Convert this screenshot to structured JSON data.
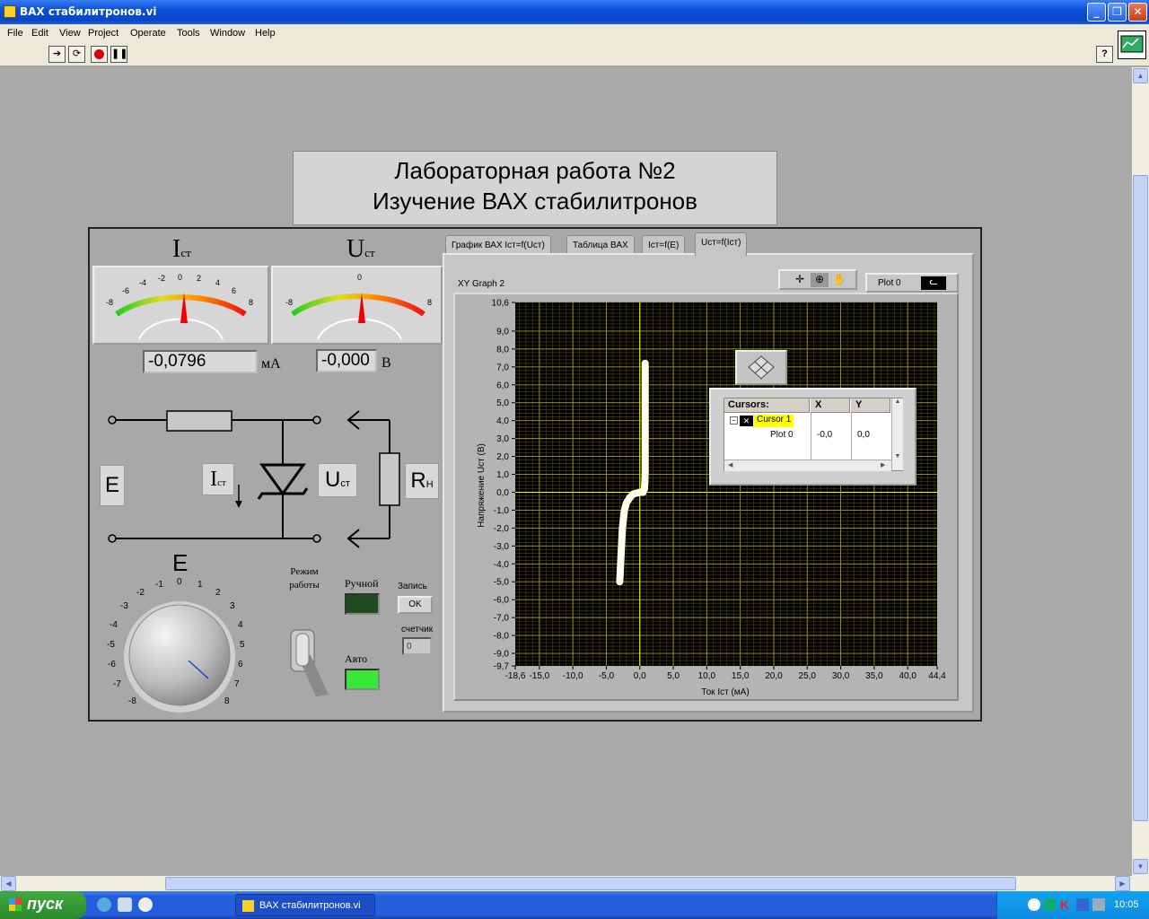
{
  "window": {
    "title": "ВАХ стабилитронов.vi"
  },
  "menu": [
    "File",
    "Edit",
    "View",
    "Project",
    "Operate",
    "Tools",
    "Window",
    "Help"
  ],
  "panel": {
    "title_line1": "Лабораторная работа №2",
    "title_line2": "Изучение ВАХ стабилитронов",
    "meter_i": {
      "label": "I",
      "sub": "ст",
      "ticks": [
        "-8",
        "-6",
        "-4",
        "-2",
        "0",
        "2",
        "4",
        "6",
        "8"
      ],
      "value": "-0,0796",
      "unit": "мА"
    },
    "meter_u": {
      "label": "U",
      "sub": "ст",
      "ticks": [
        "-8",
        "0",
        "8"
      ],
      "value": "-0,000",
      "unit": "В"
    },
    "circuit": {
      "e_label": "E",
      "i_label": "I",
      "i_sub": "ст",
      "u_label": "U",
      "u_sub": "ст",
      "r_label": "R",
      "r_sub": "Н"
    },
    "knob": {
      "label": "E",
      "ticks": [
        "-8",
        "-7",
        "-6",
        "-5",
        "-4",
        "-3",
        "-2",
        "-1",
        "0",
        "1",
        "2",
        "3",
        "4",
        "5",
        "6",
        "7",
        "8"
      ]
    },
    "mode": {
      "label": "Режим работы",
      "manual": "Ручной",
      "auto": "Авто",
      "record": "Запись",
      "ok": "OK",
      "counter_label": "счетчик",
      "counter_value": "0"
    },
    "tabs": [
      "График ВАХ Iст=f(Uст)",
      "Таблица ВАХ",
      "Iст=f(E)",
      "Uст=f(Iст)"
    ],
    "active_tab": 3,
    "graph": {
      "title": "XY Graph 2",
      "plot_legend": "Plot 0",
      "cursors": {
        "header": "Cursors:",
        "col_x": "X",
        "col_y": "Y",
        "cursor_name": "Cursor 1",
        "plot": "Plot 0",
        "x": "-0,0",
        "y": "0,0"
      }
    }
  },
  "chart_data": {
    "type": "line",
    "xlabel": "Ток Iст (мА)",
    "ylabel": "Напряжение Uст (В)",
    "xlim": [
      -18.6,
      44.4
    ],
    "ylim": [
      -9.7,
      10.6
    ],
    "x_ticks": [
      "-18,6",
      "-15,0",
      "-10,0",
      "-5,0",
      "0,0",
      "5,0",
      "10,0",
      "15,0",
      "20,0",
      "25,0",
      "30,0",
      "35,0",
      "40,0",
      "44,4"
    ],
    "y_ticks": [
      "10,6",
      "9,0",
      "8,0",
      "7,0",
      "6,0",
      "5,0",
      "4,0",
      "3,0",
      "2,0",
      "1,0",
      "0,0",
      "-1,0",
      "-2,0",
      "-3,0",
      "-4,0",
      "-5,0",
      "-6,0",
      "-7,0",
      "-8,0",
      "-9,0",
      "-9,7"
    ],
    "grid": true,
    "colors": {
      "bg": "#000000",
      "grid": "#9a9a20",
      "line": "#ffffee",
      "cursor": "#ffff00"
    },
    "x": [
      -3.0,
      -2.8,
      -2.6,
      -2.3,
      -2.0,
      -1.5,
      -1.0,
      -0.5,
      0,
      0.5,
      0.7,
      0.8,
      0.8,
      0.8,
      0.8
    ],
    "y": [
      -5.0,
      -3.5,
      -2.0,
      -1.0,
      -0.6,
      -0.3,
      -0.1,
      -0.05,
      0,
      0,
      0.2,
      1.0,
      3.0,
      5.0,
      7.2
    ]
  },
  "taskbar": {
    "start": "пуск",
    "item": "ВАХ стабилитронов.vi",
    "lang": "EN",
    "clock": "10:05"
  }
}
